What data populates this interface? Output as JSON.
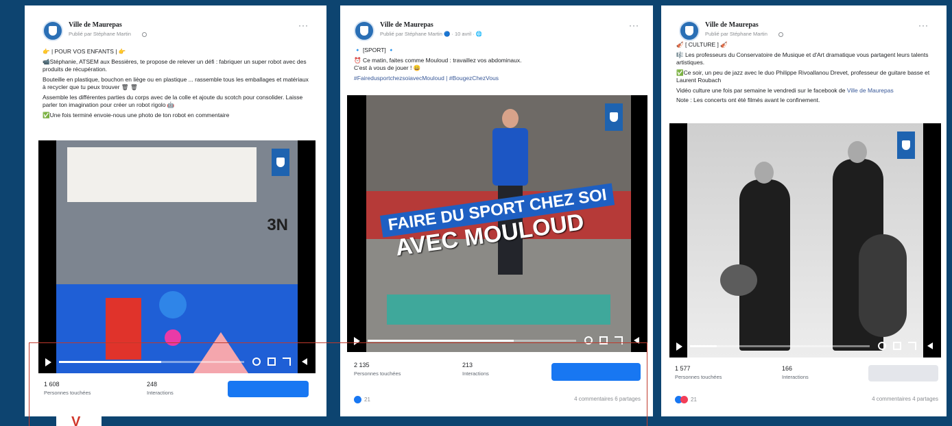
{
  "posts": [
    {
      "page_name": "Ville de Maurepas",
      "meta": "Publié par Stéphane Martin",
      "text": [
        "👉 | POUR VOS ENFANTS | 👉",
        "📹Stéphanie, ATSEM aux Bessières, te propose de relever un défi : fabriquer un super robot avec des produits de récupération.",
        "Bouteille en plastique, bouchon en liège ou en plastique ... rassemble tous les emballages et matériaux à recycler que tu peux trouver 🗑 🗑",
        "Assemble les différentes parties du corps avec de la colle et ajoute du scotch pour consolider. Laisse parler ton imagination pour créer un robot rigolo 🤖",
        "✅Une fois terminé envoie-nous une photo de ton robot en commentaire"
      ],
      "video_art_text": "3N",
      "video_progress": 0.55,
      "stats": [
        {
          "value": "1 608",
          "label": "Personnes touchées"
        },
        {
          "value": "248",
          "label": "Interactions"
        }
      ]
    },
    {
      "page_name": "Ville de Maurepas",
      "meta": "Publié par Stéphane Martin 🔵 · 10 avril · 🌐",
      "text": [
        "🔹 [SPORT] 🔹",
        "⏰ Ce matin, faites comme Mouloud : travaillez vos abdominaux.",
        "C'est à vous de jouer ! 😀"
      ],
      "hashtags": "#FairedusportchezsoiavecMouloud | #BougezChezVous",
      "banner_line_1": "FAIRE DU SPORT CHEZ SOI",
      "banner_line_2": "AVEC MOULOUD",
      "video_progress": 0.7,
      "stats": [
        {
          "value": "2 135",
          "label": "Personnes touchées"
        },
        {
          "value": "213",
          "label": "Interactions"
        }
      ],
      "reactions": "21",
      "comments_shares": "4 commentaires  6 partages"
    },
    {
      "page_name": "Ville de Maurepas",
      "meta": "Publié par Stéphane Martin",
      "text": [
        "🎻 [ CULTURE ] 🎻",
        "🎼 Les professeurs du Conservatoire de Musique et d'Art dramatique vous partagent leurs talents artistiques.",
        "✅Ce soir, un peu de jazz avec le duo Philippe Rivoallanou Drevet, professeur de guitare basse et Laurent Roubach"
      ],
      "culture_line_prefix": "Vidéo culture une fois par semaine le vendredi sur le facebook de ",
      "culture_link": "Ville de Maurepas",
      "note": "Note : Les concerts ont été filmés avant le confinement.",
      "video_progress": 0.15,
      "stats": [
        {
          "value": "1 577",
          "label": "Personnes touchées"
        },
        {
          "value": "166",
          "label": "Interactions"
        }
      ],
      "reactions": "21",
      "comments_shares": "4 commentaires  4 partages"
    }
  ],
  "highlight_marker": "V",
  "colors": {
    "background": "#0d4470",
    "boost_active": "#1877f2",
    "boost_inactive": "#e4e6eb",
    "highlight": "#c0392b"
  }
}
